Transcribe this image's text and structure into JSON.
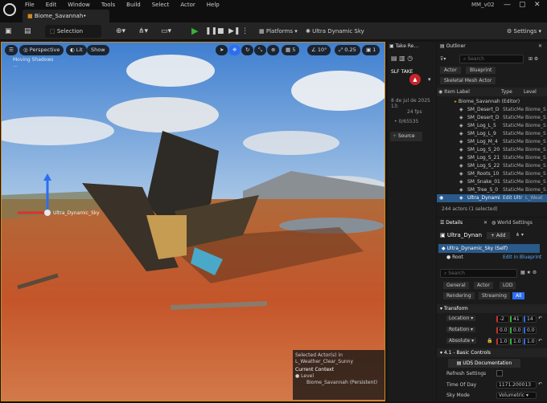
{
  "app": {
    "project": "MM_v02",
    "document_tab": "Biome_Savannah•"
  },
  "menu": [
    "File",
    "Edit",
    "Window",
    "Tools",
    "Build",
    "Select",
    "Actor",
    "Help"
  ],
  "window": {
    "minimize": "—",
    "maximize": "▢",
    "close": "✕"
  },
  "toolbar": {
    "mode": "Selection Mode",
    "platforms": "Platforms",
    "dynamic_sky": "Ultra Dynamic Sky",
    "settings": "Settings"
  },
  "viewport": {
    "perspective": "Perspective",
    "lit": "Lit",
    "show": "Show",
    "grid_count": "5",
    "angle": "10°",
    "scale": "0.25",
    "cam_speed": "1",
    "overlay_title": "Moving Shadows",
    "overlay_sub": "—",
    "actor_label": "Ultra_Dynamic_Sky",
    "ctx": {
      "selected": "Selected Actor(s) in",
      "level_name": "L_Weather_Clear_Sunny",
      "current_context": "Current Context",
      "level_label": "Level",
      "level_value": "Biome_Savannah (Persistent)"
    }
  },
  "take_recorder": {
    "title": "Take Re...",
    "slate": "SLF TAKE",
    "date": "8 de jul de 2025 13:",
    "fps": "24 fps",
    "frame": "• 0/65535",
    "source_btn": "Source"
  },
  "outliner": {
    "title": "Outliner",
    "search": "Search",
    "filters": [
      "Actor",
      "Blueprint"
    ],
    "filter_extra": "Skeletal Mesh Actor",
    "col_label": "Item Label",
    "col_type": "Type",
    "col_level": "Level",
    "root": "Biome_Savannah (Editor)",
    "rows": [
      [
        "SM_Desert_D",
        "StaticMe",
        "Biome_S"
      ],
      [
        "SM_Desert_D",
        "StaticMe",
        "Biome_S"
      ],
      [
        "SM_Log_L_5",
        "StaticMe",
        "Biome_S"
      ],
      [
        "SM_Log_L_9",
        "StaticMe",
        "Biome_S"
      ],
      [
        "SM_Log_M_4",
        "StaticMe",
        "Biome_S"
      ],
      [
        "SM_Log_S_20",
        "StaticMe",
        "Biome_S"
      ],
      [
        "SM_Log_S_21",
        "StaticMe",
        "Biome_S"
      ],
      [
        "SM_Log_S_22",
        "StaticMe",
        "Biome_S"
      ],
      [
        "SM_Roots_10",
        "StaticMe",
        "Biome_S"
      ],
      [
        "SM_Snake_01",
        "StaticMe",
        "Biome_S"
      ],
      [
        "SM_Tree_S_0",
        "StaticMe",
        "Biome_S"
      ],
      [
        "Ultra_Dynami",
        "Edit Ultr",
        "L_Weat"
      ]
    ],
    "count": "244 actors (1 selected)"
  },
  "details": {
    "title": "Details",
    "world_settings": "World Settings",
    "actor": "Ultra_Dynan",
    "add": "+ Add",
    "self": "Ultra_Dynamic_Sky (Self)",
    "root": "Root",
    "edit_bp": "Edit in Blueprint",
    "search": "Search",
    "tabs1": [
      "General",
      "Actor",
      "LOD"
    ],
    "tabs2": [
      "Rendering",
      "Streaming",
      "All"
    ],
    "transform": "Transform",
    "location": "Location",
    "rotation": "Rotation",
    "scale_label": "Absolute",
    "loc": [
      "-2",
      "41",
      "14"
    ],
    "rot": [
      "0.0",
      "0.0",
      "0.0"
    ],
    "scl": [
      "1.0",
      "1.0",
      "1.0"
    ],
    "section": "4.1 - Basic Controls",
    "uds_doc": "UDS Documentation",
    "refresh": "Refresh Settings",
    "tod_label": "Time Of Day",
    "tod_value": "1171.200013",
    "sky_mode": "Sky Mode",
    "sky_value": "Volumetric"
  },
  "colors": {
    "accent": "#d08a1c",
    "selected": "#2a5a8a",
    "play": "#3ab03a"
  }
}
